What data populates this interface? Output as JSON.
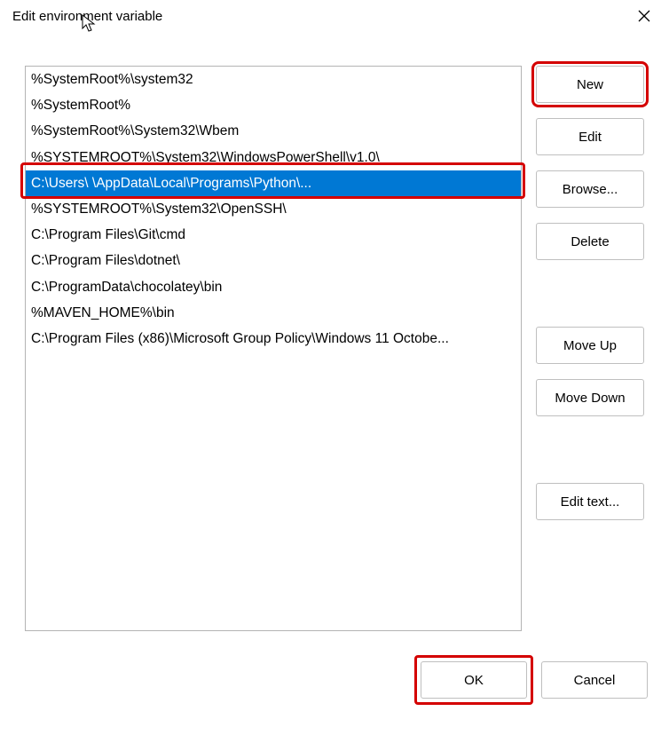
{
  "title": "Edit environment variable",
  "list": [
    "%SystemRoot%\\system32",
    "%SystemRoot%",
    "%SystemRoot%\\System32\\Wbem",
    "%SYSTEMROOT%\\System32\\WindowsPowerShell\\v1.0\\",
    "C:\\Users\\                                       \\AppData\\Local\\Programs\\Python\\...",
    "%SYSTEMROOT%\\System32\\OpenSSH\\",
    "C:\\Program Files\\Git\\cmd",
    "C:\\Program Files\\dotnet\\",
    "C:\\ProgramData\\chocolatey\\bin",
    "%MAVEN_HOME%\\bin",
    "C:\\Program Files (x86)\\Microsoft Group Policy\\Windows 11 Octobe..."
  ],
  "selectedIndex": 4,
  "buttons": {
    "new": "New",
    "edit": "Edit",
    "browse": "Browse...",
    "delete": "Delete",
    "moveUp": "Move Up",
    "moveDown": "Move Down",
    "editText": "Edit text...",
    "ok": "OK",
    "cancel": "Cancel"
  }
}
